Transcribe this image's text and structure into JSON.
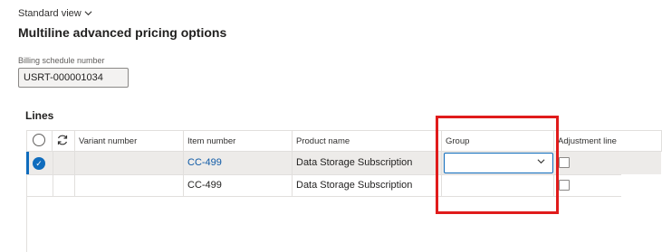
{
  "view": {
    "label": "Standard view",
    "chevron_icon": "chevron-down-icon"
  },
  "page": {
    "title": "Multiline advanced pricing options"
  },
  "billing": {
    "label": "Billing schedule number",
    "value": "USRT-000001034"
  },
  "lines": {
    "title": "Lines",
    "columns": {
      "select_icon": "radio-circle-icon",
      "refresh_icon": "refresh-icon",
      "variant": "Variant number",
      "item": "Item number",
      "product": "Product name",
      "group": "Group",
      "adjustment": "Adjustment line"
    },
    "rows": [
      {
        "selected": true,
        "variant": "",
        "item": "CC-499",
        "product": "Data Storage Subscription",
        "group": "",
        "adjustment": false
      },
      {
        "selected": false,
        "variant": "",
        "item": "CC-499",
        "product": "Data Storage Subscription",
        "group": "",
        "adjustment": false
      }
    ]
  },
  "colors": {
    "accent": "#0f6cbd",
    "link": "#0f5aa6",
    "highlight": "#e01b1b",
    "selected_row": "#edebe9"
  }
}
